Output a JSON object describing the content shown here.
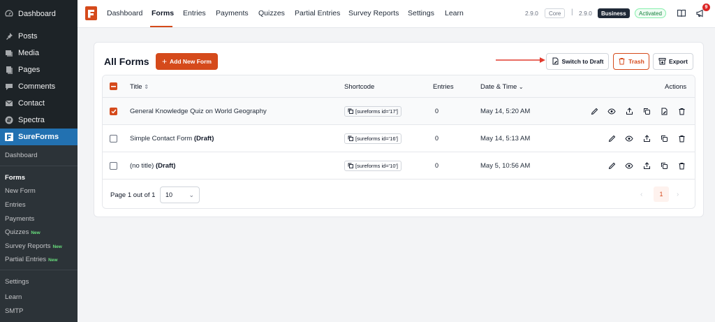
{
  "sidebar": {
    "items": [
      {
        "label": "Dashboard",
        "icon": "dashboard-icon"
      },
      {
        "label": "Posts",
        "icon": "pin-icon"
      },
      {
        "label": "Media",
        "icon": "media-icon"
      },
      {
        "label": "Pages",
        "icon": "pages-icon"
      },
      {
        "label": "Comments",
        "icon": "comment-icon"
      },
      {
        "label": "Contact",
        "icon": "mail-icon"
      },
      {
        "label": "Spectra",
        "icon": "spectra-icon"
      },
      {
        "label": "SureForms",
        "icon": "sureforms-icon"
      }
    ],
    "submenu": {
      "dashboard": "Dashboard",
      "forms": "Forms",
      "new_form": "New Form",
      "entries": "Entries",
      "payments": "Payments",
      "quizzes": "Quizzes",
      "survey_reports": "Survey Reports",
      "partial_entries": "Partial Entries",
      "settings": "Settings",
      "learn": "Learn",
      "smtp": "SMTP",
      "new_badge": "New"
    }
  },
  "topnav": {
    "items": [
      "Dashboard",
      "Forms",
      "Entries",
      "Payments",
      "Quizzes",
      "Partial Entries",
      "Survey Reports",
      "Settings",
      "Learn"
    ],
    "active": "Forms",
    "core_version": "2.9.0",
    "core_label": "Core",
    "separator": "|",
    "pro_version": "2.9.0",
    "business_label": "Business",
    "activated_label": "Activated",
    "notification_count": "9"
  },
  "card": {
    "title": "All Forms",
    "add_button": "Add New Form",
    "switch_draft_button": "Switch to Draft",
    "trash_button": "Trash",
    "export_button": "Export"
  },
  "table": {
    "headers": {
      "title": "Title",
      "shortcode": "Shortcode",
      "entries": "Entries",
      "date": "Date & Time",
      "actions": "Actions"
    },
    "rows": [
      {
        "title": "General Knowledge Quiz on World Geography",
        "draft": "",
        "shortcode": "[sureforms id='17']",
        "entries": "0",
        "date": "May 14, 5:20 AM",
        "selected": true
      },
      {
        "title": "Simple Contact Form",
        "draft": "(Draft)",
        "shortcode": "[sureforms id='16']",
        "entries": "0",
        "date": "May 14, 5:13 AM",
        "selected": false
      },
      {
        "title": "(no title)",
        "draft": "(Draft)",
        "shortcode": "[sureforms id='10']",
        "entries": "0",
        "date": "May 5, 10:56 AM",
        "selected": false
      }
    ]
  },
  "pagination": {
    "info": "Page 1 out of 1",
    "per_page": "10",
    "current_page": "1"
  },
  "colors": {
    "brand": "#d54a1b",
    "wp_sidebar": "#1d2327",
    "wp_active": "#2271b1"
  }
}
